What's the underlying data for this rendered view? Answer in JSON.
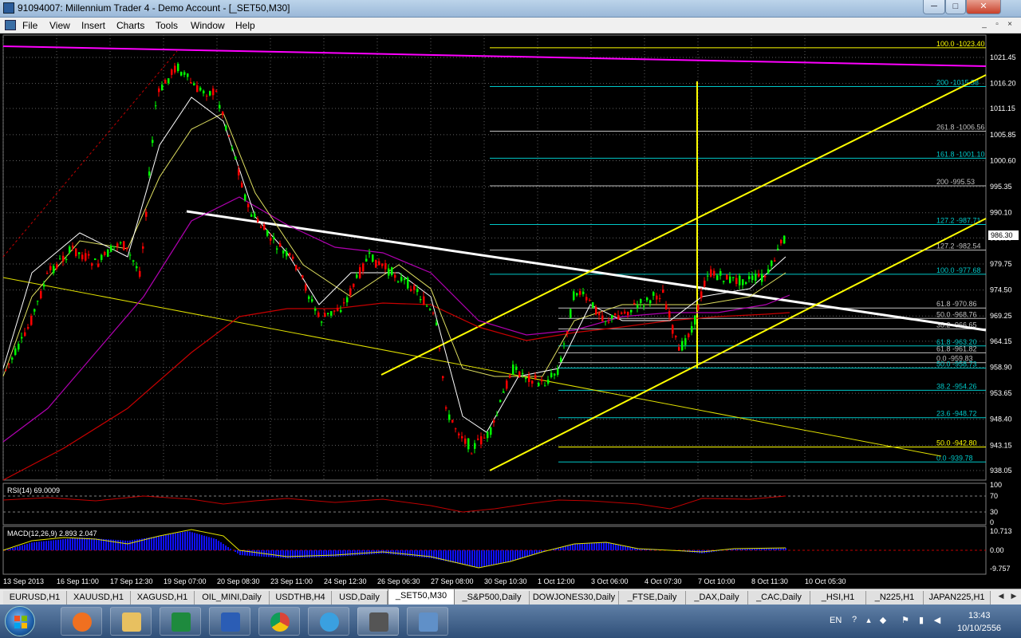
{
  "window": {
    "title": "91094007: Millennium Trader 4 - Demo Account - [_SET50,M30]",
    "minimize": "─",
    "maximize": "□",
    "close": "✕"
  },
  "menu": [
    "File",
    "View",
    "Insert",
    "Charts",
    "Tools",
    "Window",
    "Help"
  ],
  "mdi_controls": [
    "_",
    "▫",
    "×"
  ],
  "chart": {
    "symbol": "_SET50,M30",
    "current_price": "986.30",
    "colors": {
      "bull": "#00ff00",
      "bear": "#ff0000",
      "channel": "#ffff00",
      "trend": "#ffffff",
      "fib": "#00c8c8",
      "magenta": "#ff00ff",
      "ma_red": "#d00000",
      "grid": "#606060"
    },
    "price_axis": [
      "1021.45",
      "1016.20",
      "1011.15",
      "1005.85",
      "1000.60",
      "995.35",
      "990.10",
      "985.00",
      "979.75",
      "974.50",
      "969.25",
      "964.15",
      "958.90",
      "953.65",
      "948.40",
      "943.15",
      "938.05"
    ],
    "time_axis": [
      "13 Sep 2013",
      "16 Sep 11:00",
      "17 Sep 12:30",
      "19 Sep 07:00",
      "20 Sep 08:30",
      "23 Sep 11:00",
      "24 Sep 12:30",
      "26 Sep 06:30",
      "27 Sep 08:00",
      "30 Sep 10:30",
      "1 Oct 12:00",
      "3 Oct 06:00",
      "4 Oct 07:30",
      "7 Oct 10:00",
      "8 Oct 11:30",
      "10 Oct 05:30"
    ],
    "fib_levels": [
      {
        "label": "100.0 -1023.40",
        "price": 1023.4,
        "color": "#ffff00"
      },
      {
        "label": "200 -1015.58",
        "price": 1015.58,
        "color": "#00c8c8"
      },
      {
        "label": "261.8 -1006.56",
        "price": 1006.56,
        "color": "#c0c0c0"
      },
      {
        "label": "161.8 -1001.10",
        "price": 1001.1,
        "color": "#00c8c8"
      },
      {
        "label": "200 -995.53",
        "price": 995.53,
        "color": "#c0c0c0"
      },
      {
        "label": "127.2 -987.71",
        "price": 987.71,
        "color": "#00c8c8"
      },
      {
        "label": "127.2 -982.54",
        "price": 982.54,
        "color": "#c0c0c0"
      },
      {
        "label": "100.0 -977.68",
        "price": 977.68,
        "color": "#00c8c8"
      },
      {
        "label": "61.8 -970.86",
        "price": 970.86,
        "color": "#c0c0c0"
      },
      {
        "label": "50.0 -968.76",
        "price": 968.76,
        "color": "#c0c0c0"
      },
      {
        "label": "38.2 -966.65",
        "price": 966.65,
        "color": "#c0c0c0"
      },
      {
        "label": "61.8 -963.20",
        "price": 963.2,
        "color": "#00c8c8"
      },
      {
        "label": "61.8 -961.82",
        "price": 961.82,
        "color": "#c0c0c0"
      },
      {
        "label": "0.0 -959.83",
        "price": 959.83,
        "color": "#c0c0c0"
      },
      {
        "label": "50.0 -958.73",
        "price": 958.73,
        "color": "#00c8c8"
      },
      {
        "label": "38.2 -954.26",
        "price": 954.26,
        "color": "#00c8c8"
      },
      {
        "label": "23.6 -948.72",
        "price": 948.72,
        "color": "#00c8c8"
      },
      {
        "label": "50.0 -942.80",
        "price": 942.8,
        "color": "#ffff00"
      },
      {
        "label": "0.0 -939.78",
        "price": 939.78,
        "color": "#00c8c8"
      }
    ],
    "rsi": {
      "label": "RSI(14) 69.0009",
      "axis": [
        "100",
        "70",
        "30",
        "0"
      ]
    },
    "macd": {
      "label": "MACD(12,26,9) 2.893 2.047",
      "axis": [
        "10.713",
        "0.00",
        "-9.757"
      ]
    }
  },
  "symbol_tabs": [
    "EURUSD,H1",
    "XAUUSD,H1",
    "XAGUSD,H1",
    "OIL_MINI,Daily",
    "USDTHB,H4",
    "USD,Daily",
    "_SET50,M30",
    "_S&P500,Daily",
    "DOWJONES30,Daily",
    "_FTSE,Daily",
    "_DAX,Daily",
    "_CAC,Daily",
    "_HSI,H1",
    "_N225,H1",
    "JAPAN225,H1"
  ],
  "active_tab": "_SET50,M30",
  "taskbar": {
    "apps": [
      "media-player",
      "file-explorer",
      "excel",
      "word",
      "chrome",
      "internet-explorer",
      "trading-terminal",
      "trading-app"
    ],
    "lang": "EN",
    "time": "13:43",
    "date": "10/10/2556"
  }
}
